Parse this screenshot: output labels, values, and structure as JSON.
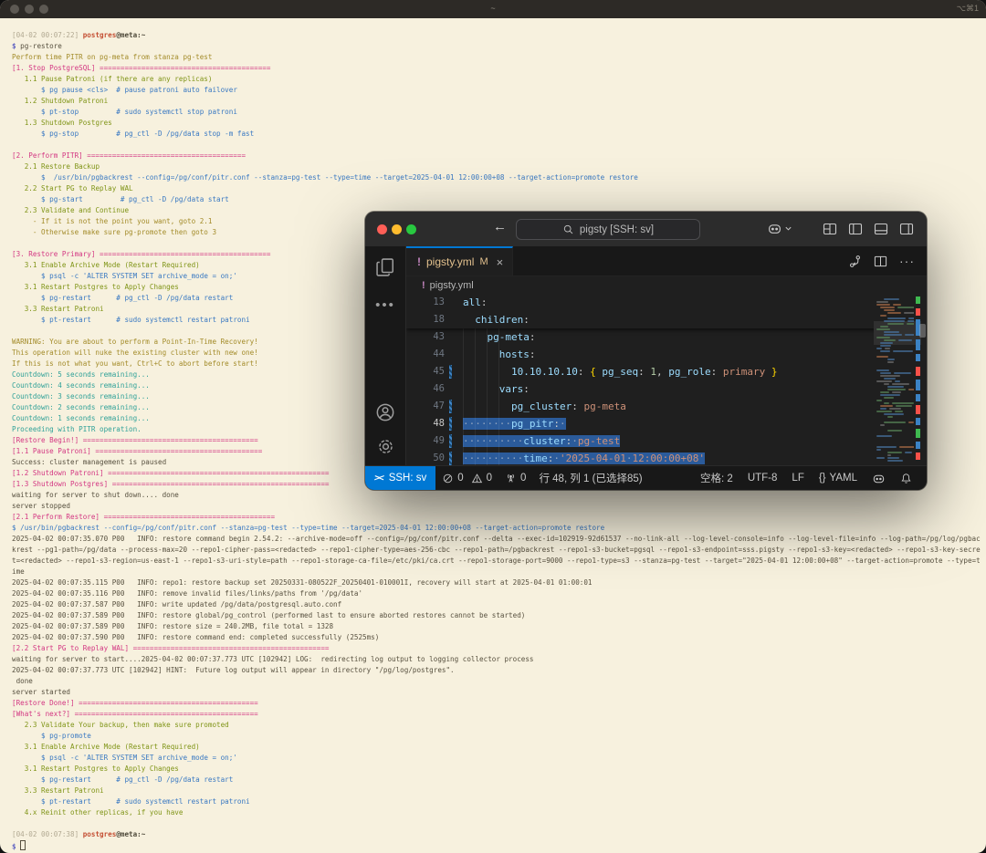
{
  "macos": {
    "title": "~",
    "hint": "⌥⌘1"
  },
  "terminal": {
    "lines": [
      [
        [
          "g",
          "[04-02 00:07:22] "
        ],
        [
          "r",
          "postgres"
        ],
        [
          "bb",
          "@meta:~"
        ]
      ],
      [
        [
          "v",
          "$ "
        ],
        [
          "b",
          "pg-restore"
        ]
      ],
      [
        [
          "y",
          "Perform time PITR on pg-meta from stanza pg-test"
        ]
      ],
      [
        [
          "m",
          "[1. Stop PostgreSQL] ========================================="
        ]
      ],
      [
        [
          "gr",
          "   1.1 Pause Patroni (if there are any replicas)"
        ]
      ],
      [
        [
          "bl",
          "       $ pg pause <cls>  # pause patroni auto failover"
        ]
      ],
      [
        [
          "gr",
          "   1.2 Shutdown Patroni"
        ]
      ],
      [
        [
          "bl",
          "       $ pt-stop         # sudo systemctl stop patroni"
        ]
      ],
      [
        [
          "gr",
          "   1.3 Shutdown Postgres"
        ]
      ],
      [
        [
          "bl",
          "       $ pg-stop         # pg_ctl -D /pg/data stop -m fast"
        ]
      ],
      [],
      [
        [
          "m",
          "[2. Perform PITR] ======================================"
        ]
      ],
      [
        [
          "gr",
          "   2.1 Restore Backup"
        ]
      ],
      [
        [
          "bl",
          "       $  /usr/bin/pgbackrest --config=/pg/conf/pitr.conf --stanza=pg-test --type=time --target=2025-04-01 12:00:00+08 --target-action=promote restore"
        ]
      ],
      [
        [
          "gr",
          "   2.2 Start PG to Replay WAL"
        ]
      ],
      [
        [
          "bl",
          "       $ pg-start         # pg_ctl -D /pg/data start"
        ]
      ],
      [
        [
          "gr",
          "   2.3 Validate and Continue"
        ]
      ],
      [
        [
          "y",
          "     - If it is not the point you want, goto 2.1"
        ]
      ],
      [
        [
          "y",
          "     - Otherwise make sure pg-promote then goto 3"
        ]
      ],
      [],
      [
        [
          "m",
          "[3. Restore Primary] ========================================="
        ]
      ],
      [
        [
          "gr",
          "   3.1 Enable Archive Mode (Restart Required)"
        ]
      ],
      [
        [
          "bl",
          "       $ psql -c 'ALTER SYSTEM SET archive_mode = on;'"
        ]
      ],
      [
        [
          "gr",
          "   3.1 Restart Postgres to Apply Changes"
        ]
      ],
      [
        [
          "bl",
          "       $ pg-restart      # pg_ctl -D /pg/data restart"
        ]
      ],
      [
        [
          "gr",
          "   3.3 Restart Patroni"
        ]
      ],
      [
        [
          "bl",
          "       $ pt-restart      # sudo systemctl restart patroni"
        ]
      ],
      [],
      [
        [
          "y",
          "WARNING: You are about to perform a Point-In-Time Recovery!"
        ]
      ],
      [
        [
          "y",
          "This operation will nuke the existing cluster with new one!"
        ]
      ],
      [
        [
          "y",
          "If this is not what you want, Ctrl+C to abort before start!"
        ]
      ],
      [
        [
          "c",
          "Countdown: 5 seconds remaining..."
        ]
      ],
      [
        [
          "c",
          "Countdown: 4 seconds remaining..."
        ]
      ],
      [
        [
          "c",
          "Countdown: 3 seconds remaining..."
        ]
      ],
      [
        [
          "c",
          "Countdown: 2 seconds remaining..."
        ]
      ],
      [
        [
          "c",
          "Countdown: 1 seconds remaining..."
        ]
      ],
      [
        [
          "c",
          "Proceeding with PITR operation."
        ]
      ],
      [
        [
          "m",
          "[Restore Begin!] =========================================="
        ]
      ],
      [
        [
          "m",
          "[1.1 Pause Patroni] ========================================"
        ]
      ],
      [
        [
          "b",
          "Success: cluster management is paused"
        ]
      ],
      [
        [
          "m",
          "[1.2 Shutdown Patroni] ====================================================="
        ]
      ],
      [
        [
          "m",
          "[1.3 Shutdown Postgres] ===================================================="
        ]
      ],
      [
        [
          "b",
          "waiting for server to shut down.... done"
        ]
      ],
      [
        [
          "b",
          "server stopped"
        ]
      ],
      [
        [
          "m",
          "[2.1 Perform Restore] ========================================="
        ]
      ],
      [
        [
          "bl",
          "$ /usr/bin/pgbackrest --config=/pg/conf/pitr.conf --stanza=pg-test --type=time --target=2025-04-01 12:00:00+08 --target-action=promote restore"
        ]
      ],
      [
        [
          "b",
          "2025-04-02 00:07:35.070 P00   INFO: restore command begin 2.54.2: --archive-mode=off --config=/pg/conf/pitr.conf --delta --exec-id=102919-92d61537 --no-link-all --log-level-console=info --log-level-file=info --log-path=/pg/log/pgbackrest --pg1-path=/pg/data --process-max=20 --repo1-cipher-pass=<redacted> --repo1-cipher-type=aes-256-cbc --repo1-path=/pgbackrest --repo1-s3-bucket=pgsql --repo1-s3-endpoint=sss.pigsty --repo1-s3-key=<redacted> --repo1-s3-key-secret=<redacted> --repo1-s3-region=us-east-1 --repo1-s3-uri-style=path --repo1-storage-ca-file=/etc/pki/ca.crt --repo1-storage-port=9000 --repo1-type=s3 --stanza=pg-test --target=\"2025-04-01 12:00:00+08\" --target-action=promote --type=time"
        ]
      ],
      [
        [
          "b",
          "2025-04-02 00:07:35.115 P00   INFO: repo1: restore backup set 20250331-080522F_20250401-010001I, recovery will start at 2025-04-01 01:00:01"
        ]
      ],
      [
        [
          "b",
          "2025-04-02 00:07:35.116 P00   INFO: remove invalid files/links/paths from '/pg/data'"
        ]
      ],
      [
        [
          "b",
          "2025-04-02 00:07:37.587 P00   INFO: write updated /pg/data/postgresql.auto.conf"
        ]
      ],
      [
        [
          "b",
          "2025-04-02 00:07:37.589 P00   INFO: restore global/pg_control (performed last to ensure aborted restores cannot be started)"
        ]
      ],
      [
        [
          "b",
          "2025-04-02 00:07:37.589 P00   INFO: restore size = 240.2MB, file total = 1328"
        ]
      ],
      [
        [
          "b",
          "2025-04-02 00:07:37.590 P00   INFO: restore command end: completed successfully (2525ms)"
        ]
      ],
      [
        [
          "m",
          "[2.2 Start PG to Replay WAL] ==============================================="
        ]
      ],
      [
        [
          "b",
          "waiting for server to start....2025-04-02 00:07:37.773 UTC [102942] LOG:  redirecting log output to logging collector process"
        ]
      ],
      [
        [
          "b",
          "2025-04-02 00:07:37.773 UTC [102942] HINT:  Future log output will appear in directory \"/pg/log/postgres\"."
        ]
      ],
      [
        [
          "b",
          " done"
        ]
      ],
      [
        [
          "b",
          "server started"
        ]
      ],
      [
        [
          "m",
          "[Restore Done!] ==========================================="
        ]
      ],
      [
        [
          "m",
          "[What's next?] ============================================"
        ]
      ],
      [
        [
          "gr",
          "   2.3 Validate Your backup, then make sure promoted"
        ]
      ],
      [
        [
          "bl",
          "       $ pg-promote"
        ]
      ],
      [
        [
          "gr",
          "   3.1 Enable Archive Mode (Restart Required)"
        ]
      ],
      [
        [
          "bl",
          "       $ psql -c 'ALTER SYSTEM SET archive_mode = on;'"
        ]
      ],
      [
        [
          "gr",
          "   3.1 Restart Postgres to Apply Changes"
        ]
      ],
      [
        [
          "bl",
          "       $ pg-restart      # pg_ctl -D /pg/data restart"
        ]
      ],
      [
        [
          "gr",
          "   3.3 Restart Patroni"
        ]
      ],
      [
        [
          "bl",
          "       $ pt-restart      # sudo systemctl restart patroni"
        ]
      ],
      [
        [
          "gr",
          "   4.x Reinit other replicas, if you have"
        ]
      ],
      [],
      [
        [
          "g",
          "[04-02 00:07:38] "
        ],
        [
          "r",
          "postgres"
        ],
        [
          "bb",
          "@meta:~"
        ]
      ],
      [
        [
          "v",
          "$ "
        ],
        [
          "cur",
          ""
        ]
      ]
    ]
  },
  "vscode": {
    "search": "pigsty [SSH: sv]",
    "tab": {
      "badge": "!",
      "name": "pigsty.yml",
      "mod": "M",
      "close": "×"
    },
    "breadcrumb": {
      "badge": "!",
      "name": "pigsty.yml"
    },
    "sticky": [
      {
        "num": "13",
        "segs": [
          [
            "key",
            "all"
          ],
          [
            "pun",
            ":"
          ]
        ]
      },
      {
        "num": "18",
        "segs": [
          [
            "pln",
            "  "
          ],
          [
            "key",
            "children"
          ],
          [
            "pun",
            ":"
          ]
        ]
      }
    ],
    "code": [
      {
        "num": "43",
        "segs": [
          [
            "pln",
            "    "
          ],
          [
            "key",
            "pg-meta"
          ],
          [
            "pun",
            ":"
          ]
        ]
      },
      {
        "num": "44",
        "segs": [
          [
            "pln",
            "      "
          ],
          [
            "key",
            "hosts"
          ],
          [
            "pun",
            ":"
          ]
        ]
      },
      {
        "num": "45",
        "m": 1,
        "segs": [
          [
            "pln",
            "        "
          ],
          [
            "key",
            "10.10.10.10"
          ],
          [
            "pun",
            ":"
          ],
          [
            "pln",
            " "
          ],
          [
            "brc",
            "{"
          ],
          [
            "pln",
            " "
          ],
          [
            "key",
            "pg_seq"
          ],
          [
            "pun",
            ":"
          ],
          [
            "pln",
            " "
          ],
          [
            "num",
            "1"
          ],
          [
            "pun",
            ","
          ],
          [
            "pln",
            " "
          ],
          [
            "key",
            "pg_role"
          ],
          [
            "pun",
            ":"
          ],
          [
            "pln",
            " "
          ],
          [
            "str",
            "primary"
          ],
          [
            "pln",
            " "
          ],
          [
            "brc",
            "}"
          ]
        ]
      },
      {
        "num": "46",
        "segs": [
          [
            "pln",
            "      "
          ],
          [
            "key",
            "vars"
          ],
          [
            "pun",
            ":"
          ]
        ]
      },
      {
        "num": "47",
        "m": 1,
        "segs": [
          [
            "pln",
            "        "
          ],
          [
            "key",
            "pg_cluster"
          ],
          [
            "pun",
            ":"
          ],
          [
            "pln",
            " "
          ],
          [
            "str",
            "pg-meta"
          ]
        ]
      },
      {
        "num": "48",
        "m": 1,
        "cur": 1,
        "sel": 1,
        "segs": [
          [
            "wsd",
            "········"
          ],
          [
            "key",
            "pg_pitr"
          ],
          [
            "pun",
            ":"
          ],
          [
            "wsd",
            "·"
          ]
        ]
      },
      {
        "num": "49",
        "m": 1,
        "sel": 1,
        "segs": [
          [
            "wsd",
            "··········"
          ],
          [
            "key",
            "cluster"
          ],
          [
            "pun",
            ":"
          ],
          [
            "wsd",
            "·"
          ],
          [
            "str",
            "pg-test"
          ]
        ]
      },
      {
        "num": "50",
        "m": 1,
        "sel": 1,
        "segs": [
          [
            "wsd",
            "··········"
          ],
          [
            "key",
            "time"
          ],
          [
            "pun",
            ":"
          ],
          [
            "wsd",
            "·"
          ],
          [
            "str",
            "'2025-04-01"
          ],
          [
            "wsd",
            "·"
          ],
          [
            "str",
            "12:00:00+08'"
          ]
        ]
      }
    ],
    "minimap_decorations": [
      {
        "t": 3,
        "h": 8,
        "c": "#3fb950"
      },
      {
        "t": 16,
        "h": 8,
        "c": "#f85149"
      },
      {
        "t": 28,
        "h": 18,
        "c": "#3b82c4"
      },
      {
        "t": 50,
        "h": 12,
        "c": "#3b82c4"
      },
      {
        "t": 66,
        "h": 8,
        "c": "#3b82c4"
      },
      {
        "t": 80,
        "h": 10,
        "c": "#f85149"
      },
      {
        "t": 94,
        "h": 12,
        "c": "#3b82c4"
      },
      {
        "t": 110,
        "h": 8,
        "c": "#3b82c4"
      },
      {
        "t": 122,
        "h": 10,
        "c": "#f85149"
      },
      {
        "t": 136,
        "h": 8,
        "c": "#3b82c4"
      },
      {
        "t": 148,
        "h": 10,
        "c": "#3fb950"
      },
      {
        "t": 162,
        "h": 8,
        "c": "#3b82c4"
      },
      {
        "t": 174,
        "h": 8,
        "c": "#f85149"
      }
    ],
    "status": {
      "remote": "SSH: sv",
      "errors": "0",
      "warnings": "0",
      "ports": "0",
      "cursor": "行 48, 列 1 (已选择85)",
      "indent": "空格: 2",
      "encoding": "UTF-8",
      "eol": "LF",
      "braces": "{}",
      "lang": "YAML"
    },
    "colors": {
      "accent": "#0078d4",
      "modified": "#e2c08d",
      "badge": "#c586c0",
      "selection": "#2b5b9b"
    }
  }
}
